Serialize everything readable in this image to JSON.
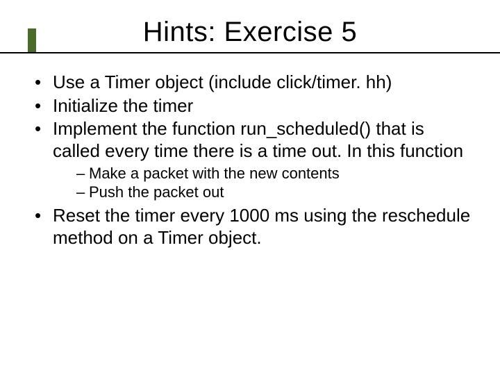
{
  "title": "Hints: Exercise 5",
  "bullets": {
    "b0": "Use a Timer object (include click/timer. hh)",
    "b1": "Initialize the timer",
    "b2": "Implement the function run_scheduled() that is called every time there is a time out. In this function",
    "b3": "Reset the timer every 1000 ms using the reschedule method on a Timer object."
  },
  "sub": {
    "s0": "Make a packet with the new contents",
    "s1": "Push the packet out"
  }
}
